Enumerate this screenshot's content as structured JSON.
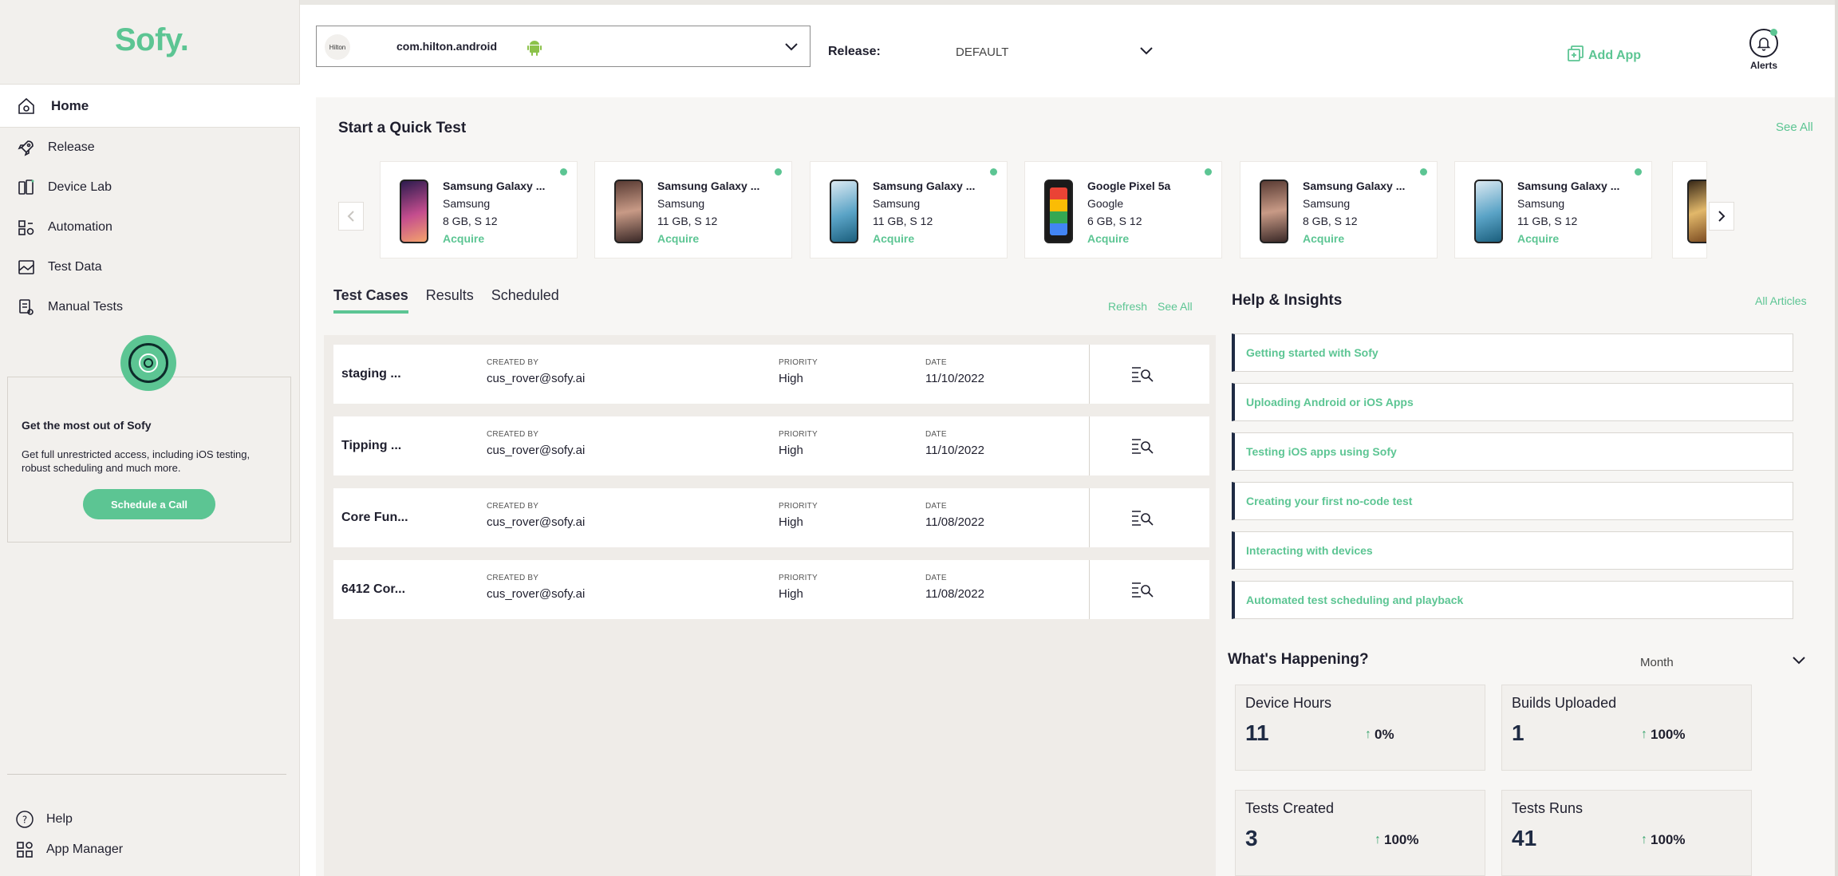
{
  "sidebar": {
    "logo": "Sofy.",
    "nav": [
      {
        "label": "Home",
        "icon": "home-icon"
      },
      {
        "label": "Release",
        "icon": "rocket-icon"
      },
      {
        "label": "Device Lab",
        "icon": "devices-icon"
      },
      {
        "label": "Automation",
        "icon": "automation-icon"
      },
      {
        "label": "Test Data",
        "icon": "test-data-icon"
      },
      {
        "label": "Manual Tests",
        "icon": "manual-tests-icon"
      }
    ],
    "promo": {
      "title": "Get the most out of Sofy",
      "text": "Get full unrestricted access, including iOS testing, robust scheduling and much more.",
      "button": "Schedule a Call"
    },
    "bottom": [
      {
        "label": "Help",
        "icon": "help-icon"
      },
      {
        "label": "App Manager",
        "icon": "app-manager-icon"
      }
    ]
  },
  "topbar": {
    "app_logo_text": "Hilton",
    "app_name": "com.hilton.android",
    "release_label": "Release:",
    "release_value": "DEFAULT",
    "add_app": "Add App",
    "alerts": "Alerts"
  },
  "quick_test": {
    "title": "Start a Quick Test",
    "see_all": "See All",
    "devices": [
      {
        "name": "Samsung Galaxy ...",
        "brand": "Samsung",
        "spec": "8 GB, S 12",
        "action": "Acquire"
      },
      {
        "name": "Samsung Galaxy ...",
        "brand": "Samsung",
        "spec": "11 GB, S 12",
        "action": "Acquire"
      },
      {
        "name": "Samsung Galaxy ...",
        "brand": "Samsung",
        "spec": "11 GB, S 12",
        "action": "Acquire"
      },
      {
        "name": "Google Pixel 5a",
        "brand": "Google",
        "spec": "6 GB, S 12",
        "action": "Acquire"
      },
      {
        "name": "Samsung Galaxy ...",
        "brand": "Samsung",
        "spec": "8 GB, S 12",
        "action": "Acquire"
      },
      {
        "name": "Samsung Galaxy ...",
        "brand": "Samsung",
        "spec": "11 GB, S 12",
        "action": "Acquire"
      }
    ]
  },
  "tests": {
    "tabs": [
      "Test Cases",
      "Results",
      "Scheduled"
    ],
    "refresh": "Refresh",
    "see_all": "See All",
    "label_created_by": "CREATED BY",
    "label_priority": "PRIORITY",
    "label_date": "DATE",
    "rows": [
      {
        "name": "staging ...",
        "created_by": "cus_rover@sofy.ai",
        "priority": "High",
        "date": "11/10/2022"
      },
      {
        "name": "Tipping ...",
        "created_by": "cus_rover@sofy.ai",
        "priority": "High",
        "date": "11/10/2022"
      },
      {
        "name": "Core Fun...",
        "created_by": "cus_rover@sofy.ai",
        "priority": "High",
        "date": "11/08/2022"
      },
      {
        "name": "6412 Cor...",
        "created_by": "cus_rover@sofy.ai",
        "priority": "High",
        "date": "11/08/2022"
      }
    ]
  },
  "help": {
    "title": "Help & Insights",
    "all_articles": "All Articles",
    "articles": [
      "Getting started with Sofy",
      "Uploading Android or iOS Apps",
      "Testing iOS apps using Sofy",
      "Creating your first no-code test",
      "Interacting with devices",
      "Automated test scheduling and playback"
    ]
  },
  "happening": {
    "title": "What's Happening?",
    "period": "Month",
    "stats": [
      {
        "title": "Device Hours",
        "value": "11",
        "change": "0%"
      },
      {
        "title": "Builds Uploaded",
        "value": "1",
        "change": "100%"
      },
      {
        "title": "Tests Created",
        "value": "3",
        "change": "100%"
      },
      {
        "title": "Tests Runs",
        "value": "41",
        "change": "100%"
      }
    ]
  },
  "colors": {
    "accent": "#5cc593",
    "sidebar_bg": "#f2f0ed",
    "navy": "#1f2b44"
  }
}
